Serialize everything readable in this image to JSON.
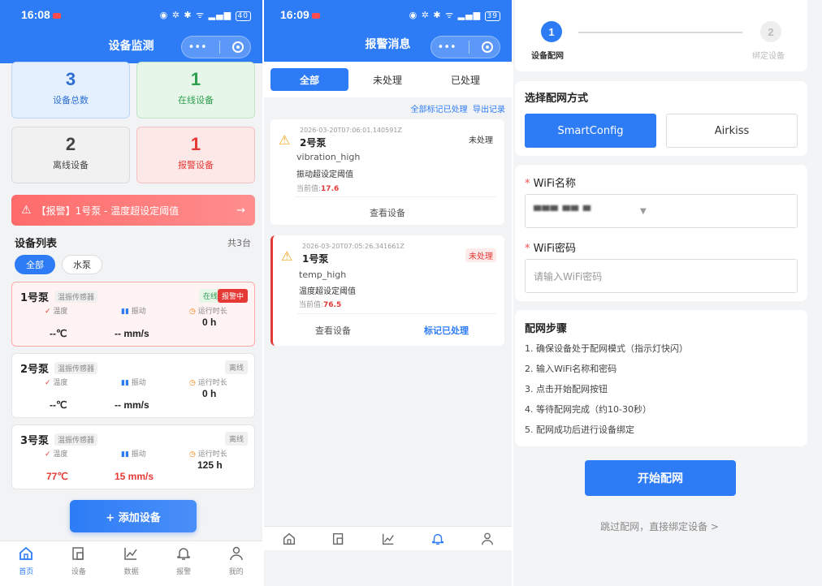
{
  "monitor": {
    "status_time": "16:08",
    "status_icons": "◉ ✲ ✱ ᯤ ▂▄▆",
    "battery": "40",
    "title": "设备监测",
    "capsule_dots": "•••",
    "stats": [
      {
        "value": "3",
        "label": "设备总数"
      },
      {
        "value": "1",
        "label": "在线设备"
      },
      {
        "value": "2",
        "label": "离线设备"
      },
      {
        "value": "1",
        "label": "报警设备"
      }
    ],
    "alert_banner": "【报警】1号泵 - 温度超设定阈值",
    "alert_arrow": "→",
    "list_title": "设备列表",
    "list_count": "共3台",
    "filters": [
      "全部",
      "水泵"
    ],
    "metric_labels": {
      "temp": "温度",
      "vib": "振动",
      "runtime": "运行时长"
    },
    "devices": [
      {
        "name": "1号泵",
        "type": "温振传感器",
        "status": "在线",
        "alarm": "报警中",
        "temp": "--℃",
        "vib": "-- mm/s",
        "runtime": "0 h"
      },
      {
        "name": "2号泵",
        "type": "温振传感器",
        "status": "离线",
        "temp": "--℃",
        "vib": "-- mm/s",
        "runtime": "0 h"
      },
      {
        "name": "3号泵",
        "type": "温振传感器",
        "status": "离线",
        "temp": "77℃",
        "vib": "15 mm/s",
        "runtime": "125 h"
      }
    ],
    "add_button": "+ 添加设备",
    "tabs": [
      "首页",
      "设备",
      "数据",
      "报警",
      "我的"
    ]
  },
  "alarms": {
    "status_time": "16:09",
    "status_icons": "◉ ✲ ✱ ᯤ ▂▄▆",
    "battery": "39",
    "title": "报警消息",
    "capsule_dots": "•••",
    "segments": [
      "全部",
      "未处理",
      "已处理"
    ],
    "mark_all": "全部标记已处理",
    "export": "导出记录",
    "current_label": "当前值:",
    "items": [
      {
        "time": "2026-03-20T07:06:01.140591Z",
        "device": "2号泵",
        "status": "未处理",
        "code": "vibration_high",
        "desc": "振动超设定阈值",
        "current": "17.6",
        "action": "查看设备"
      },
      {
        "time": "2026-03-20T07:05:26.341661Z",
        "device": "1号泵",
        "status": "未处理",
        "code": "temp_high",
        "desc": "温度超设定阈值",
        "current": "76.5",
        "action": "查看设备",
        "action2": "标记已处理"
      }
    ]
  },
  "config": {
    "steps": [
      {
        "num": "1",
        "label": "设备配网"
      },
      {
        "num": "2",
        "label": "绑定设备"
      }
    ],
    "method_title": "选择配网方式",
    "methods": [
      "SmartConfig",
      "Airkiss"
    ],
    "req_mark": "*",
    "wifi_name_label": "WiFi名称",
    "wifi_name_value": "▀▀▀ ▀▀  ▀",
    "dropdown_icon": "▼",
    "wifi_pwd_label": "WiFi密码",
    "wifi_pwd_placeholder": "请输入WiFi密码",
    "steps_title": "配网步骤",
    "step_lines": [
      "1. 确保设备处于配网模式（指示灯快闪）",
      "2. 输入WiFi名称和密码",
      "3. 点击开始配网按钮",
      "4. 等待配网完成（约10-30秒）",
      "5. 配网成功后进行设备绑定"
    ],
    "start_button": "开始配网",
    "skip_link": "跳过配网，直接绑定设备 >"
  },
  "colors": {
    "primary": "#2d7cf6",
    "danger": "#e53935",
    "success": "#2e9e4f"
  }
}
